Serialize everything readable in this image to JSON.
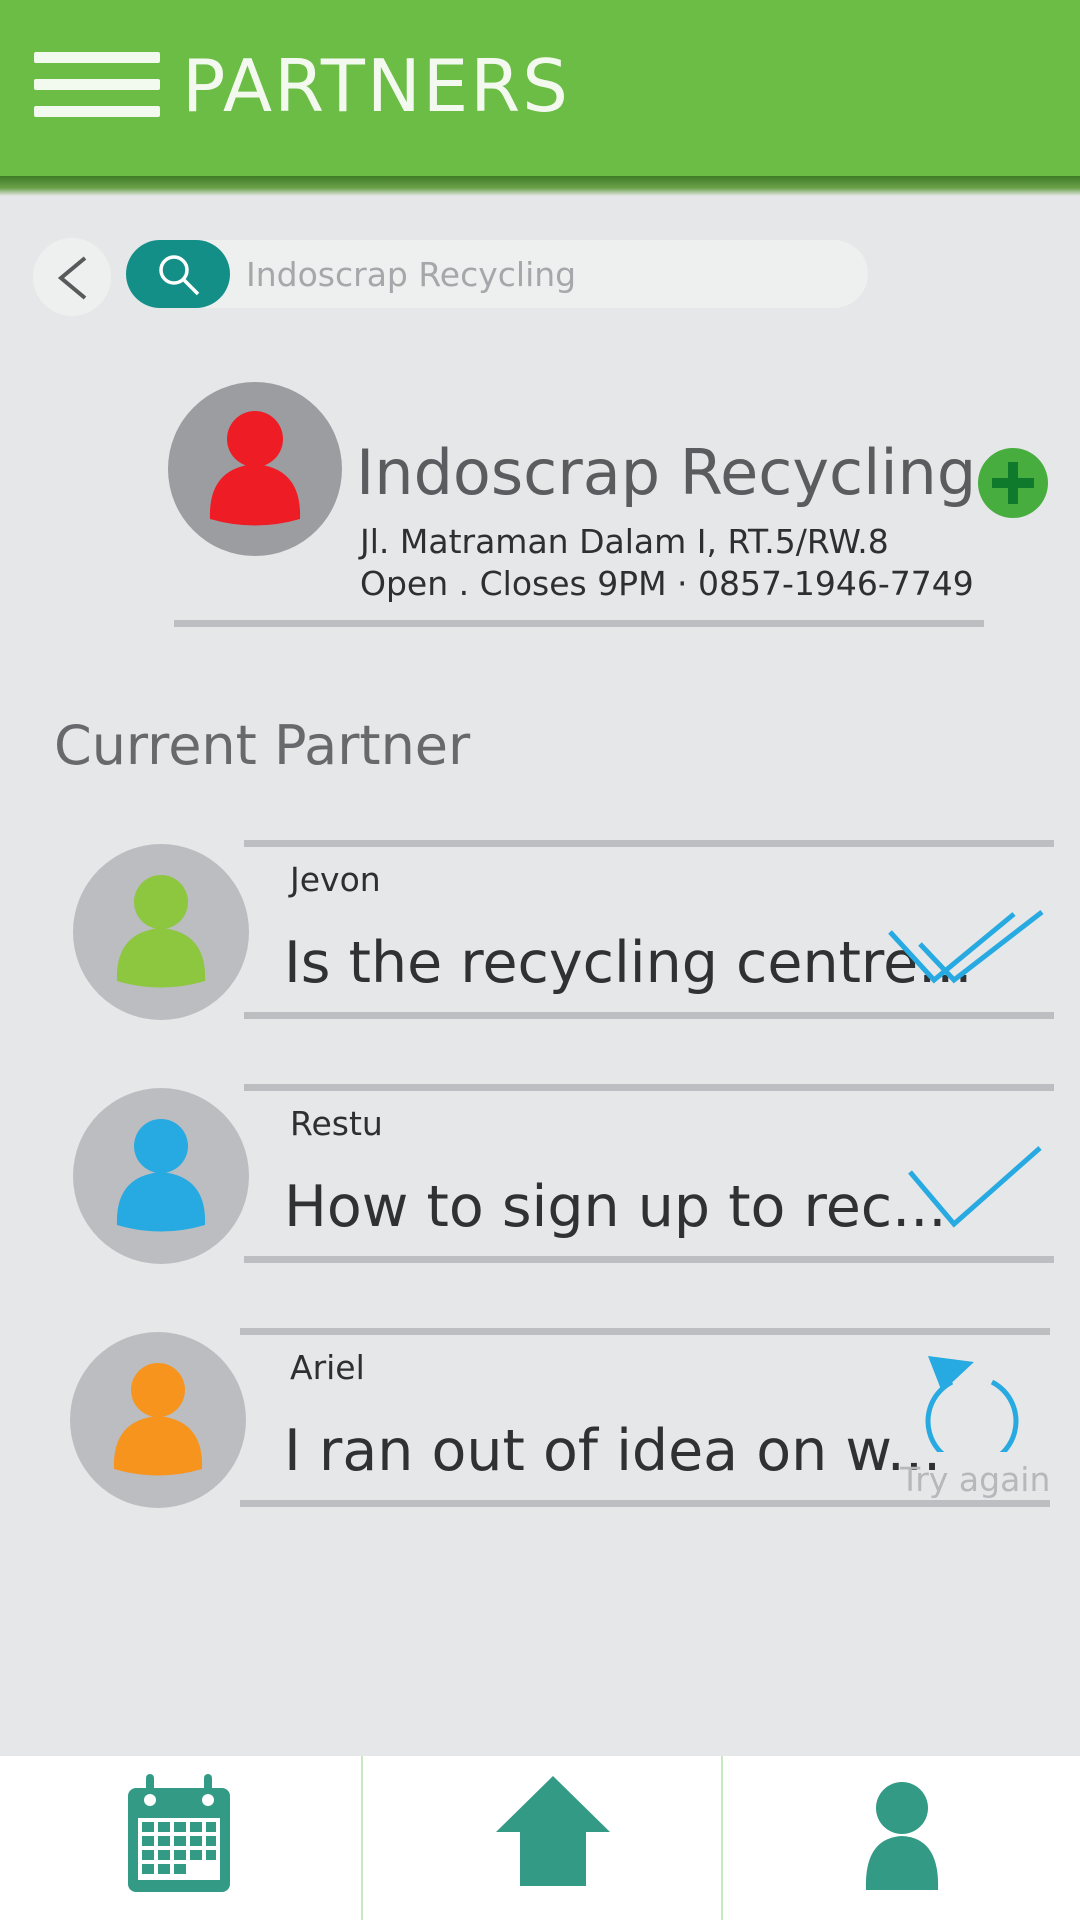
{
  "header": {
    "title": "PARTNERS"
  },
  "search": {
    "placeholder": "Indoscrap Recycling",
    "value": ""
  },
  "business": {
    "name": "Indoscrap Recycling",
    "address": "Jl. Matraman Dalam I, RT.5/RW.8",
    "hours_phone": "Open . Closes 9PM · 0857-1946-7749",
    "avatar_color": "#ee1c25"
  },
  "section": {
    "title": "Current Partner"
  },
  "chats": [
    {
      "name": "Jevon",
      "message": "Is the recycling centre...",
      "status": "read",
      "avatar_color": "#8dc63f"
    },
    {
      "name": "Restu",
      "message": "How to sign up to rec...",
      "status": "sent",
      "avatar_color": "#27aae1"
    },
    {
      "name": "Ariel",
      "message": "I ran out of idea on w...",
      "status": "failed",
      "status_label": "Try again",
      "avatar_color": "#f7941d"
    }
  ],
  "colors": {
    "header": "#6bbd45",
    "accent": "#148f88",
    "nav_icon": "#339a85",
    "check": "#27aae1"
  },
  "nav": [
    {
      "icon": "calendar-icon"
    },
    {
      "icon": "home-icon"
    },
    {
      "icon": "profile-icon"
    }
  ]
}
